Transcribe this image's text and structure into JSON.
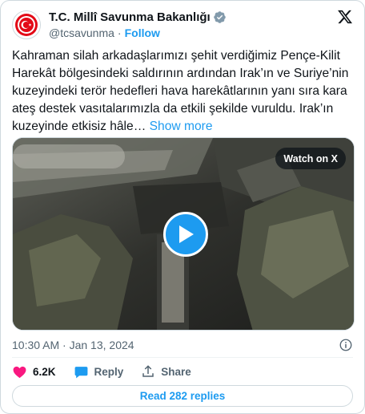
{
  "account": {
    "display_name": "T.C. Millî Savunma Bakanlığı",
    "handle": "@tcsavunma",
    "separator": "·",
    "follow_label": "Follow"
  },
  "tweet": {
    "text": "Kahraman silah arkadaşlarımızı şehit verdiğimiz Pençe-Kilit Harekât bölgesindeki saldırının ardından Irak’ın ve Suriye’nin kuzeyindeki terör hedefleri hava harekâtlarının yanı sıra kara ateş destek vasıtalarımızla da etkili şekilde vuruldu. Irak’ın kuzeyinde etkisiz hâle…",
    "show_more": "Show more",
    "watch_label": "Watch on X",
    "timestamp": "10:30 AM · Jan 13, 2024"
  },
  "actions": {
    "likes": "6.2K",
    "reply_label": "Reply",
    "share_label": "Share"
  },
  "footer": {
    "read_replies": "Read 282 replies"
  },
  "colors": {
    "accent": "#1d9bf0",
    "like": "#f91880",
    "text": "#0f1419",
    "muted": "#536471",
    "emblem": "#e30a17"
  },
  "icons": {
    "avatar": "ministry-emblem-icon",
    "verified": "verified-badge-icon",
    "logo": "x-logo-icon",
    "play": "play-icon",
    "info": "info-icon",
    "like": "heart-icon",
    "reply": "reply-bubble-icon",
    "share": "share-icon"
  }
}
